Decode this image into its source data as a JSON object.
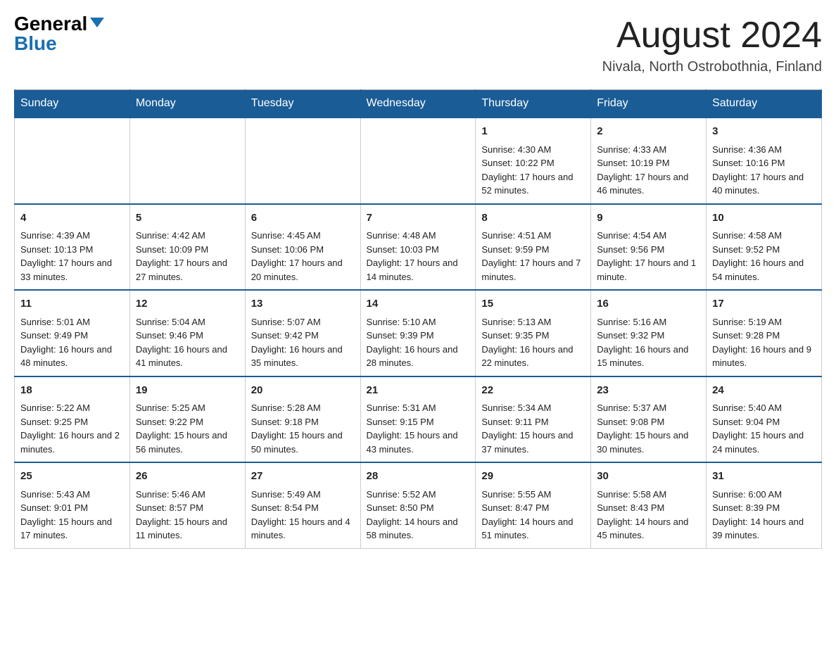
{
  "header": {
    "logo_general": "General",
    "logo_blue": "Blue",
    "month_title": "August 2024",
    "location": "Nivala, North Ostrobothnia, Finland"
  },
  "days_of_week": [
    "Sunday",
    "Monday",
    "Tuesday",
    "Wednesday",
    "Thursday",
    "Friday",
    "Saturday"
  ],
  "weeks": [
    [
      {
        "day": "",
        "info": ""
      },
      {
        "day": "",
        "info": ""
      },
      {
        "day": "",
        "info": ""
      },
      {
        "day": "",
        "info": ""
      },
      {
        "day": "1",
        "info": "Sunrise: 4:30 AM\nSunset: 10:22 PM\nDaylight: 17 hours and 52 minutes."
      },
      {
        "day": "2",
        "info": "Sunrise: 4:33 AM\nSunset: 10:19 PM\nDaylight: 17 hours and 46 minutes."
      },
      {
        "day": "3",
        "info": "Sunrise: 4:36 AM\nSunset: 10:16 PM\nDaylight: 17 hours and 40 minutes."
      }
    ],
    [
      {
        "day": "4",
        "info": "Sunrise: 4:39 AM\nSunset: 10:13 PM\nDaylight: 17 hours and 33 minutes."
      },
      {
        "day": "5",
        "info": "Sunrise: 4:42 AM\nSunset: 10:09 PM\nDaylight: 17 hours and 27 minutes."
      },
      {
        "day": "6",
        "info": "Sunrise: 4:45 AM\nSunset: 10:06 PM\nDaylight: 17 hours and 20 minutes."
      },
      {
        "day": "7",
        "info": "Sunrise: 4:48 AM\nSunset: 10:03 PM\nDaylight: 17 hours and 14 minutes."
      },
      {
        "day": "8",
        "info": "Sunrise: 4:51 AM\nSunset: 9:59 PM\nDaylight: 17 hours and 7 minutes."
      },
      {
        "day": "9",
        "info": "Sunrise: 4:54 AM\nSunset: 9:56 PM\nDaylight: 17 hours and 1 minute."
      },
      {
        "day": "10",
        "info": "Sunrise: 4:58 AM\nSunset: 9:52 PM\nDaylight: 16 hours and 54 minutes."
      }
    ],
    [
      {
        "day": "11",
        "info": "Sunrise: 5:01 AM\nSunset: 9:49 PM\nDaylight: 16 hours and 48 minutes."
      },
      {
        "day": "12",
        "info": "Sunrise: 5:04 AM\nSunset: 9:46 PM\nDaylight: 16 hours and 41 minutes."
      },
      {
        "day": "13",
        "info": "Sunrise: 5:07 AM\nSunset: 9:42 PM\nDaylight: 16 hours and 35 minutes."
      },
      {
        "day": "14",
        "info": "Sunrise: 5:10 AM\nSunset: 9:39 PM\nDaylight: 16 hours and 28 minutes."
      },
      {
        "day": "15",
        "info": "Sunrise: 5:13 AM\nSunset: 9:35 PM\nDaylight: 16 hours and 22 minutes."
      },
      {
        "day": "16",
        "info": "Sunrise: 5:16 AM\nSunset: 9:32 PM\nDaylight: 16 hours and 15 minutes."
      },
      {
        "day": "17",
        "info": "Sunrise: 5:19 AM\nSunset: 9:28 PM\nDaylight: 16 hours and 9 minutes."
      }
    ],
    [
      {
        "day": "18",
        "info": "Sunrise: 5:22 AM\nSunset: 9:25 PM\nDaylight: 16 hours and 2 minutes."
      },
      {
        "day": "19",
        "info": "Sunrise: 5:25 AM\nSunset: 9:22 PM\nDaylight: 15 hours and 56 minutes."
      },
      {
        "day": "20",
        "info": "Sunrise: 5:28 AM\nSunset: 9:18 PM\nDaylight: 15 hours and 50 minutes."
      },
      {
        "day": "21",
        "info": "Sunrise: 5:31 AM\nSunset: 9:15 PM\nDaylight: 15 hours and 43 minutes."
      },
      {
        "day": "22",
        "info": "Sunrise: 5:34 AM\nSunset: 9:11 PM\nDaylight: 15 hours and 37 minutes."
      },
      {
        "day": "23",
        "info": "Sunrise: 5:37 AM\nSunset: 9:08 PM\nDaylight: 15 hours and 30 minutes."
      },
      {
        "day": "24",
        "info": "Sunrise: 5:40 AM\nSunset: 9:04 PM\nDaylight: 15 hours and 24 minutes."
      }
    ],
    [
      {
        "day": "25",
        "info": "Sunrise: 5:43 AM\nSunset: 9:01 PM\nDaylight: 15 hours and 17 minutes."
      },
      {
        "day": "26",
        "info": "Sunrise: 5:46 AM\nSunset: 8:57 PM\nDaylight: 15 hours and 11 minutes."
      },
      {
        "day": "27",
        "info": "Sunrise: 5:49 AM\nSunset: 8:54 PM\nDaylight: 15 hours and 4 minutes."
      },
      {
        "day": "28",
        "info": "Sunrise: 5:52 AM\nSunset: 8:50 PM\nDaylight: 14 hours and 58 minutes."
      },
      {
        "day": "29",
        "info": "Sunrise: 5:55 AM\nSunset: 8:47 PM\nDaylight: 14 hours and 51 minutes."
      },
      {
        "day": "30",
        "info": "Sunrise: 5:58 AM\nSunset: 8:43 PM\nDaylight: 14 hours and 45 minutes."
      },
      {
        "day": "31",
        "info": "Sunrise: 6:00 AM\nSunset: 8:39 PM\nDaylight: 14 hours and 39 minutes."
      }
    ]
  ]
}
